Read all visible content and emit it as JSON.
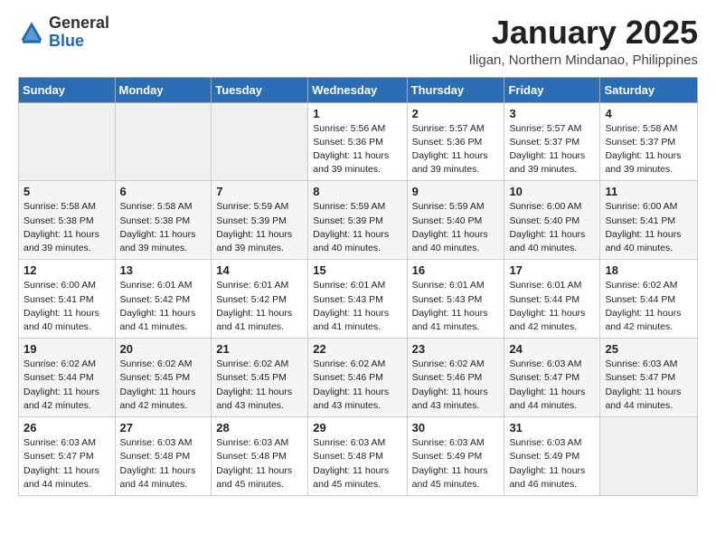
{
  "header": {
    "logo_general": "General",
    "logo_blue": "Blue",
    "month_title": "January 2025",
    "location": "Iligan, Northern Mindanao, Philippines"
  },
  "days_of_week": [
    "Sunday",
    "Monday",
    "Tuesday",
    "Wednesday",
    "Thursday",
    "Friday",
    "Saturday"
  ],
  "weeks": [
    [
      {
        "day": "",
        "sunrise": "",
        "sunset": "",
        "daylight": ""
      },
      {
        "day": "",
        "sunrise": "",
        "sunset": "",
        "daylight": ""
      },
      {
        "day": "",
        "sunrise": "",
        "sunset": "",
        "daylight": ""
      },
      {
        "day": "1",
        "sunrise": "Sunrise: 5:56 AM",
        "sunset": "Sunset: 5:36 PM",
        "daylight": "Daylight: 11 hours and 39 minutes."
      },
      {
        "day": "2",
        "sunrise": "Sunrise: 5:57 AM",
        "sunset": "Sunset: 5:36 PM",
        "daylight": "Daylight: 11 hours and 39 minutes."
      },
      {
        "day": "3",
        "sunrise": "Sunrise: 5:57 AM",
        "sunset": "Sunset: 5:37 PM",
        "daylight": "Daylight: 11 hours and 39 minutes."
      },
      {
        "day": "4",
        "sunrise": "Sunrise: 5:58 AM",
        "sunset": "Sunset: 5:37 PM",
        "daylight": "Daylight: 11 hours and 39 minutes."
      }
    ],
    [
      {
        "day": "5",
        "sunrise": "Sunrise: 5:58 AM",
        "sunset": "Sunset: 5:38 PM",
        "daylight": "Daylight: 11 hours and 39 minutes."
      },
      {
        "day": "6",
        "sunrise": "Sunrise: 5:58 AM",
        "sunset": "Sunset: 5:38 PM",
        "daylight": "Daylight: 11 hours and 39 minutes."
      },
      {
        "day": "7",
        "sunrise": "Sunrise: 5:59 AM",
        "sunset": "Sunset: 5:39 PM",
        "daylight": "Daylight: 11 hours and 39 minutes."
      },
      {
        "day": "8",
        "sunrise": "Sunrise: 5:59 AM",
        "sunset": "Sunset: 5:39 PM",
        "daylight": "Daylight: 11 hours and 40 minutes."
      },
      {
        "day": "9",
        "sunrise": "Sunrise: 5:59 AM",
        "sunset": "Sunset: 5:40 PM",
        "daylight": "Daylight: 11 hours and 40 minutes."
      },
      {
        "day": "10",
        "sunrise": "Sunrise: 6:00 AM",
        "sunset": "Sunset: 5:40 PM",
        "daylight": "Daylight: 11 hours and 40 minutes."
      },
      {
        "day": "11",
        "sunrise": "Sunrise: 6:00 AM",
        "sunset": "Sunset: 5:41 PM",
        "daylight": "Daylight: 11 hours and 40 minutes."
      }
    ],
    [
      {
        "day": "12",
        "sunrise": "Sunrise: 6:00 AM",
        "sunset": "Sunset: 5:41 PM",
        "daylight": "Daylight: 11 hours and 40 minutes."
      },
      {
        "day": "13",
        "sunrise": "Sunrise: 6:01 AM",
        "sunset": "Sunset: 5:42 PM",
        "daylight": "Daylight: 11 hours and 41 minutes."
      },
      {
        "day": "14",
        "sunrise": "Sunrise: 6:01 AM",
        "sunset": "Sunset: 5:42 PM",
        "daylight": "Daylight: 11 hours and 41 minutes."
      },
      {
        "day": "15",
        "sunrise": "Sunrise: 6:01 AM",
        "sunset": "Sunset: 5:43 PM",
        "daylight": "Daylight: 11 hours and 41 minutes."
      },
      {
        "day": "16",
        "sunrise": "Sunrise: 6:01 AM",
        "sunset": "Sunset: 5:43 PM",
        "daylight": "Daylight: 11 hours and 41 minutes."
      },
      {
        "day": "17",
        "sunrise": "Sunrise: 6:01 AM",
        "sunset": "Sunset: 5:44 PM",
        "daylight": "Daylight: 11 hours and 42 minutes."
      },
      {
        "day": "18",
        "sunrise": "Sunrise: 6:02 AM",
        "sunset": "Sunset: 5:44 PM",
        "daylight": "Daylight: 11 hours and 42 minutes."
      }
    ],
    [
      {
        "day": "19",
        "sunrise": "Sunrise: 6:02 AM",
        "sunset": "Sunset: 5:44 PM",
        "daylight": "Daylight: 11 hours and 42 minutes."
      },
      {
        "day": "20",
        "sunrise": "Sunrise: 6:02 AM",
        "sunset": "Sunset: 5:45 PM",
        "daylight": "Daylight: 11 hours and 42 minutes."
      },
      {
        "day": "21",
        "sunrise": "Sunrise: 6:02 AM",
        "sunset": "Sunset: 5:45 PM",
        "daylight": "Daylight: 11 hours and 43 minutes."
      },
      {
        "day": "22",
        "sunrise": "Sunrise: 6:02 AM",
        "sunset": "Sunset: 5:46 PM",
        "daylight": "Daylight: 11 hours and 43 minutes."
      },
      {
        "day": "23",
        "sunrise": "Sunrise: 6:02 AM",
        "sunset": "Sunset: 5:46 PM",
        "daylight": "Daylight: 11 hours and 43 minutes."
      },
      {
        "day": "24",
        "sunrise": "Sunrise: 6:03 AM",
        "sunset": "Sunset: 5:47 PM",
        "daylight": "Daylight: 11 hours and 44 minutes."
      },
      {
        "day": "25",
        "sunrise": "Sunrise: 6:03 AM",
        "sunset": "Sunset: 5:47 PM",
        "daylight": "Daylight: 11 hours and 44 minutes."
      }
    ],
    [
      {
        "day": "26",
        "sunrise": "Sunrise: 6:03 AM",
        "sunset": "Sunset: 5:47 PM",
        "daylight": "Daylight: 11 hours and 44 minutes."
      },
      {
        "day": "27",
        "sunrise": "Sunrise: 6:03 AM",
        "sunset": "Sunset: 5:48 PM",
        "daylight": "Daylight: 11 hours and 44 minutes."
      },
      {
        "day": "28",
        "sunrise": "Sunrise: 6:03 AM",
        "sunset": "Sunset: 5:48 PM",
        "daylight": "Daylight: 11 hours and 45 minutes."
      },
      {
        "day": "29",
        "sunrise": "Sunrise: 6:03 AM",
        "sunset": "Sunset: 5:48 PM",
        "daylight": "Daylight: 11 hours and 45 minutes."
      },
      {
        "day": "30",
        "sunrise": "Sunrise: 6:03 AM",
        "sunset": "Sunset: 5:49 PM",
        "daylight": "Daylight: 11 hours and 45 minutes."
      },
      {
        "day": "31",
        "sunrise": "Sunrise: 6:03 AM",
        "sunset": "Sunset: 5:49 PM",
        "daylight": "Daylight: 11 hours and 46 minutes."
      },
      {
        "day": "",
        "sunrise": "",
        "sunset": "",
        "daylight": ""
      }
    ]
  ]
}
